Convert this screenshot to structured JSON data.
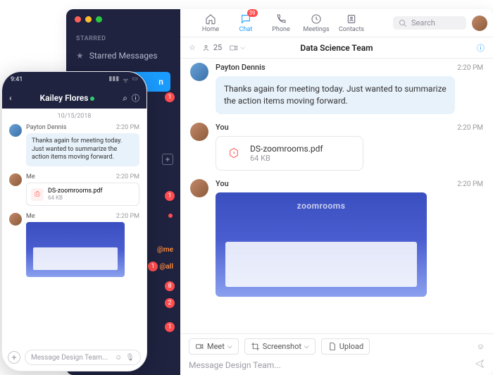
{
  "topnav": {
    "home": "Home",
    "chat": "Chat",
    "phone": "Phone",
    "meetings": "Meetings",
    "contacts": "Contacts",
    "chat_badge": "39",
    "search_placeholder": "Search"
  },
  "sidebar": {
    "section_starred": "STARRED",
    "starred_label": "Starred Messages",
    "join_label": "n",
    "filters": {
      "me": "@me",
      "all": "@all"
    },
    "badges": {
      "b1": "1",
      "b2": "1",
      "b3": "1",
      "b4": "8",
      "b5": "2",
      "b6": "1"
    }
  },
  "chat": {
    "channel_title": "Data Science Team",
    "member_count": "25",
    "messages": [
      {
        "sender": "Payton Dennis",
        "time": "2:20 PM",
        "text": "Thanks again for meeting today. Just wanted to summarize the action items moving forward."
      },
      {
        "sender": "You",
        "time": "2:20 PM",
        "file": {
          "name": "DS-zoomrooms.pdf",
          "size": "64 KB"
        }
      },
      {
        "sender": "You",
        "time": "2:20 PM",
        "image_brand": "zoomrooms"
      }
    ],
    "footer": {
      "meet": "Meet",
      "screenshot": "Screenshot",
      "upload": "Upload",
      "placeholder": "Message Design Team..."
    }
  },
  "phone": {
    "time": "9:41",
    "title": "Kailey Flores",
    "date": "10/15/2018",
    "messages": [
      {
        "sender": "Payton Dennis",
        "time": "2:20 PM",
        "text": "Thanks again for meeting today. Just wanted to summarize the action items moving forward."
      },
      {
        "sender": "Me",
        "time": "2:20 PM",
        "file": {
          "name": "DS-zoomrooms.pdf",
          "size": "64 KB"
        }
      },
      {
        "sender": "Me",
        "time": "2:20 PM"
      }
    ],
    "compose_placeholder": "Message Design Team..."
  }
}
